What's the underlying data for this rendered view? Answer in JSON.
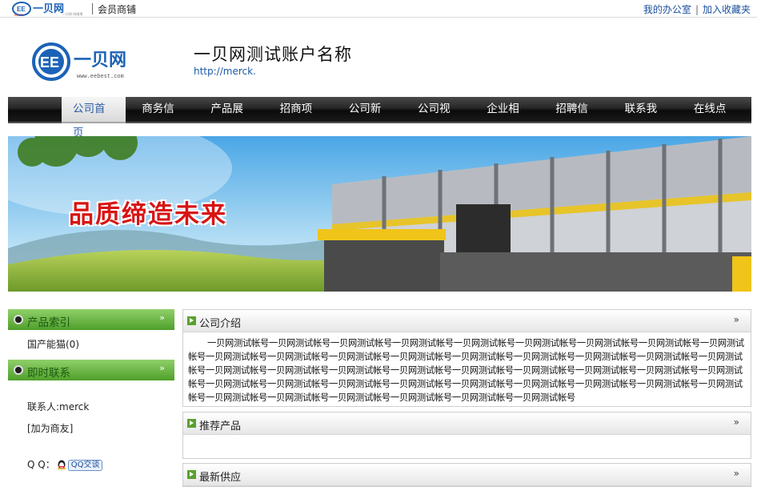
{
  "topbar": {
    "logo_text": "一贝网",
    "logo_badge": "EE",
    "logo_sub": "BEST",
    "member_label": "会员商铺",
    "office_link": "我的办公室",
    "separator": "|",
    "favorite_link": "加入收藏夹"
  },
  "header": {
    "brand_text": "一贝网",
    "brand_badge": "EE",
    "brand_url": "www.eebest.com",
    "company_name": "一贝网测试账户名称",
    "company_url": "http://merck."
  },
  "nav": {
    "items": [
      "公司首页",
      "商务信息",
      "产品展厅",
      "招商项目",
      "公司新闻",
      "公司视频",
      "企业相册",
      "招聘信息",
      "联系我们",
      "在线点评"
    ]
  },
  "banner": {
    "slogan": "品质缔造未来"
  },
  "sidebar": {
    "product_index_title": "产品索引",
    "product_item": "国产能猫(0)",
    "contact_title": "即时联系",
    "contact_person": "联系人:merck",
    "add_friend": "[加为商友]",
    "qq_label": "Q Q：",
    "qq_button": "QQ交谈",
    "arrow": "»"
  },
  "panels": {
    "intro_title": "公司介绍",
    "intro_text": "一贝网测试帐号一贝网测试帐号一贝网测试帐号一贝网测试帐号一贝网测试帐号一贝网测试帐号一贝网测试帐号一贝网测试帐号一贝网测试帐号一贝网测试帐号一贝网测试帐号一贝网测试帐号一贝网测试帐号一贝网测试帐号一贝网测试帐号一贝网测试帐号一贝网测试帐号一贝网测试帐号一贝网测试帐号一贝网测试帐号一贝网测试帐号一贝网测试帐号一贝网测试帐号一贝网测试帐号一贝网测试帐号一贝网测试帐号一贝网测试帐号一贝网测试帐号一贝网测试帐号一贝网测试帐号一贝网测试帐号一贝网测试帐号一贝网测试帐号一贝网测试帐号一贝网测试帐号一贝网测试帐号一贝网测试帐号一贝网测试帐号一贝网测试帐号一贝网测试帐号一贝网测试帐号一贝网测试帐号",
    "recommend_title": "推荐产品",
    "supply_title": "最新供应",
    "arrow": "»"
  }
}
